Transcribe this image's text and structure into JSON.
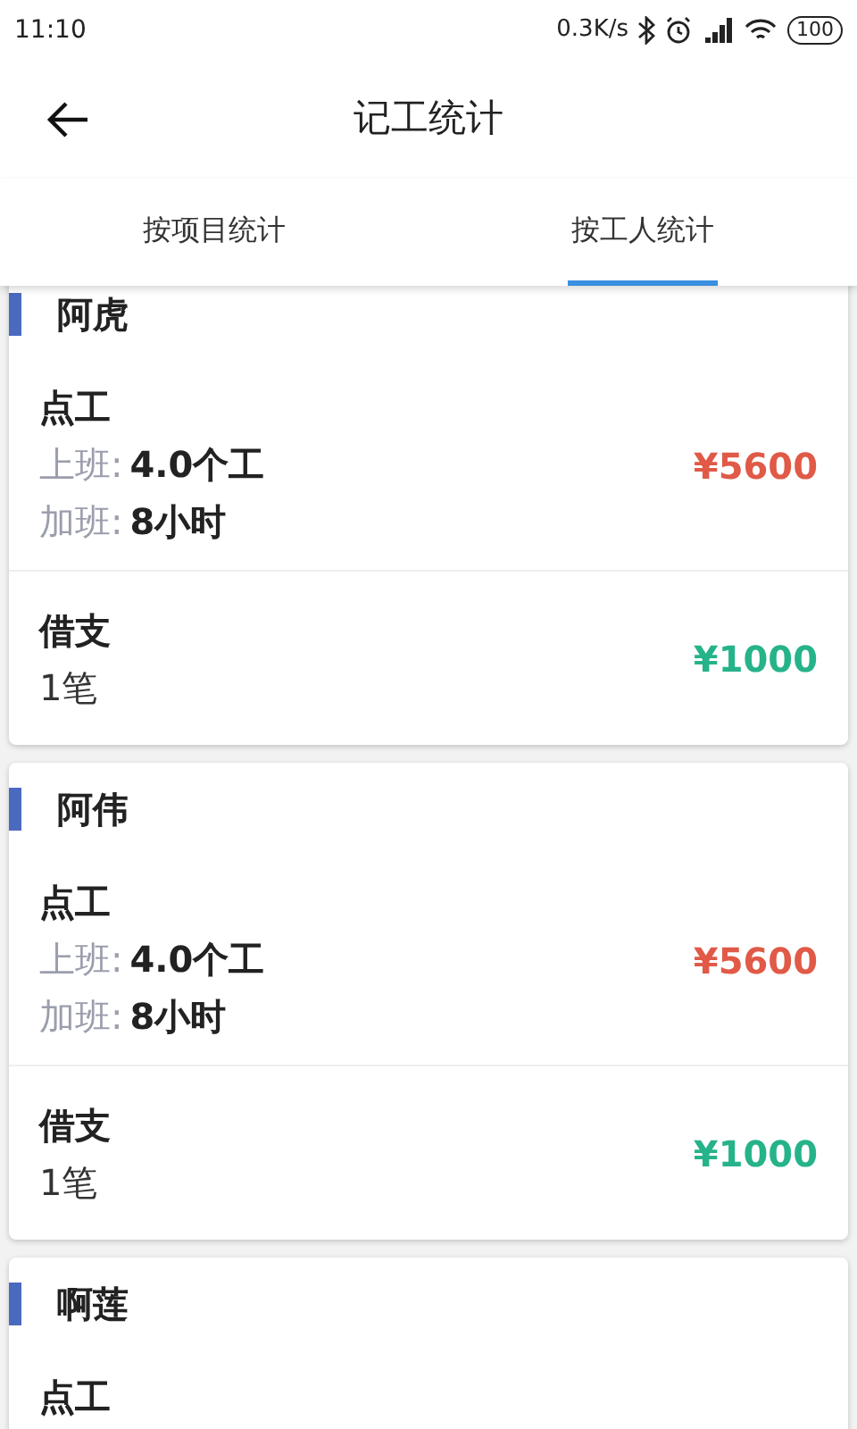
{
  "status_bar": {
    "time": "11:10",
    "speed": "0.3K/s",
    "battery": "100"
  },
  "header": {
    "title": "记工统计"
  },
  "tabs": [
    {
      "label": "按项目统计",
      "selected": false
    },
    {
      "label": "按工人统计",
      "selected": true
    }
  ],
  "workers": [
    {
      "name": "阿虎",
      "entries": [
        {
          "kind": "work",
          "title": "点工",
          "lines": [
            {
              "label": "上班:",
              "value": "4.0个工"
            },
            {
              "label": "加班:",
              "value": "8小时"
            }
          ],
          "amount": "¥5600"
        },
        {
          "kind": "loan",
          "title": "借支",
          "count": "1笔",
          "amount": "¥1000"
        }
      ]
    },
    {
      "name": "阿伟",
      "entries": [
        {
          "kind": "work",
          "title": "点工",
          "lines": [
            {
              "label": "上班:",
              "value": "4.0个工"
            },
            {
              "label": "加班:",
              "value": "8小时"
            }
          ],
          "amount": "¥5600"
        },
        {
          "kind": "loan",
          "title": "借支",
          "count": "1笔",
          "amount": "¥1000"
        }
      ]
    },
    {
      "name": "啊莲",
      "entries": [
        {
          "kind": "work",
          "title": "点工"
        }
      ]
    }
  ]
}
